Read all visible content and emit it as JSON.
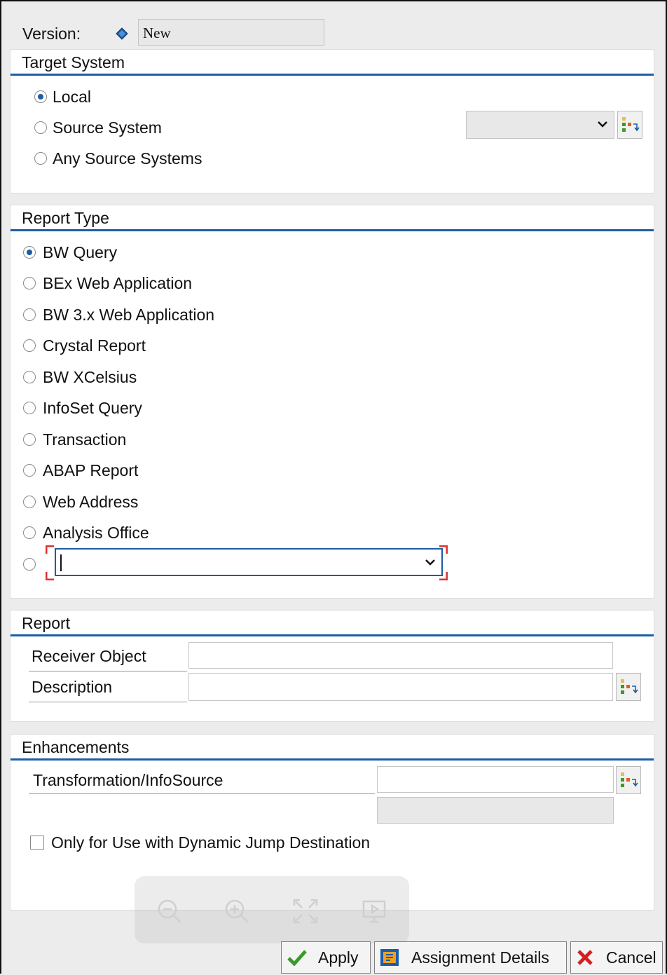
{
  "version": {
    "label": "Version:",
    "value": "New"
  },
  "target_system": {
    "title": "Target System",
    "options": [
      "Local",
      "Source System",
      "Any Source Systems"
    ],
    "selected": "Local",
    "source_system_select_value": ""
  },
  "report_type": {
    "title": "Report Type",
    "options": [
      "BW Query",
      "BEx Web Application",
      "BW 3.x Web Application",
      "Crystal Report",
      "BW XCelsius",
      "InfoSet Query",
      "Transaction",
      "ABAP Report",
      "Web Address",
      "Analysis Office"
    ],
    "selected": "BW Query",
    "other_select_value": ""
  },
  "report": {
    "title": "Report",
    "receiver_object_label": "Receiver Object",
    "receiver_object_value": "",
    "description_label": "Description",
    "description_value": ""
  },
  "enhancements": {
    "title": "Enhancements",
    "transformation_label": "Transformation/InfoSource",
    "transformation_value": "",
    "transformation_text": "",
    "dynamic_jump_label": "Only for Use with Dynamic Jump Destination",
    "dynamic_jump_checked": false
  },
  "viewer_toolbar": {
    "icons": [
      "zoom-out-icon",
      "zoom-in-icon",
      "fit-to-screen-icon",
      "presentation-icon"
    ]
  },
  "buttons": {
    "apply": "Apply",
    "assignment_details": "Assignment Details",
    "cancel": "Cancel"
  },
  "colors": {
    "accent_blue": "#1c5da5",
    "apply_green": "#3a9a2a",
    "cancel_red": "#d02020",
    "focus_red": "#e03030"
  }
}
